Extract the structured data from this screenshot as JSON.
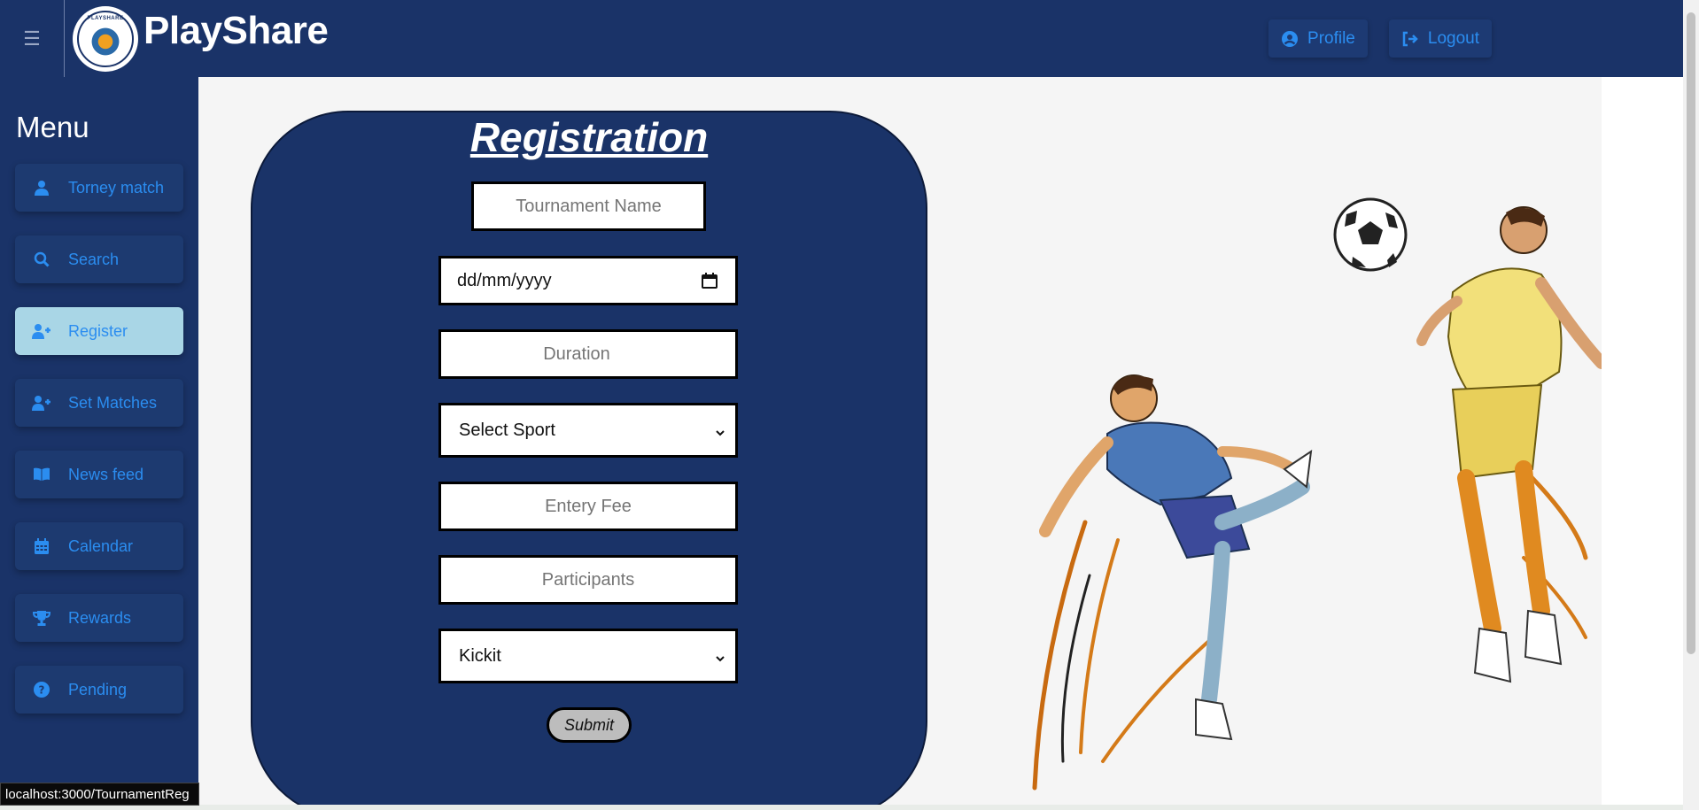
{
  "app": {
    "brand": "PlayShare",
    "logo_text": "PLAYSHARE"
  },
  "header": {
    "profile_label": "Profile",
    "logout_label": "Logout",
    "accent": "#2b8df0",
    "background": "#1a3368"
  },
  "sidebar": {
    "title": "Menu",
    "items": [
      {
        "label": "Torney match",
        "icon": "user-icon"
      },
      {
        "label": "Search",
        "icon": "search-icon"
      },
      {
        "label": "Register",
        "icon": "user-plus-icon",
        "active": true
      },
      {
        "label": "Set Matches",
        "icon": "user-plus-icon"
      },
      {
        "label": "News feed",
        "icon": "book-icon"
      },
      {
        "label": "Calendar",
        "icon": "calendar-icon"
      },
      {
        "label": "Rewards",
        "icon": "trophy-icon"
      },
      {
        "label": "Pending",
        "icon": "question-circle-icon"
      }
    ]
  },
  "form": {
    "title": "Registration",
    "tournament_name_placeholder": "Tournament Name",
    "date_placeholder": "dd/mm/yyyy",
    "duration_placeholder": "Duration",
    "sport_select_value": "Select Sport",
    "entry_fee_placeholder": "Entery Fee",
    "participants_placeholder": "Participants",
    "format_select_value": "Kickit",
    "submit_label": "Submit"
  },
  "status_bar": {
    "url": "localhost:3000/TournamentReg"
  }
}
